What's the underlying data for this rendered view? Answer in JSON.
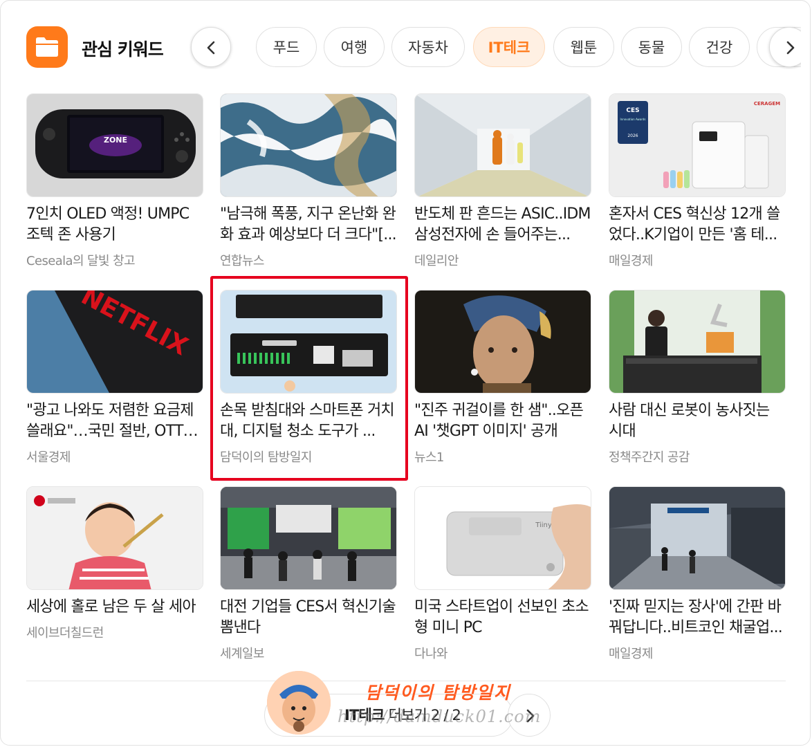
{
  "header": {
    "title": "관심 키워드",
    "tabs": [
      {
        "label": "푸드",
        "active": false
      },
      {
        "label": "여행",
        "active": false
      },
      {
        "label": "자동차",
        "active": false
      },
      {
        "label": "IT테크",
        "active": true
      },
      {
        "label": "웹툰",
        "active": false
      },
      {
        "label": "동물",
        "active": false
      },
      {
        "label": "건강",
        "active": false
      }
    ]
  },
  "cards": [
    {
      "title": "7인치 OLED 액정! UMPC 조텍 존 사용기",
      "source": "Ceseala의 달빛 창고"
    },
    {
      "title": "\"남극해 폭풍, 지구 온난화 완화 효과 예상보다 더 크다\"[...",
      "source": "연합뉴스"
    },
    {
      "title": "반도체 판 흔드는 ASIC..IDM 삼성전자에 손 들어주는...",
      "source": "데일리안"
    },
    {
      "title": "혼자서 CES 혁신상 12개 쓸었다..K기업이 만든 '홈 테...",
      "source": "매일경제"
    },
    {
      "title": "\"광고 나와도 저렴한 요금제 쓸래요\"…국민 절반, OTT '...",
      "source": "서울경제"
    },
    {
      "title": "손목 받침대와 스마트폰 거치대, 디지털 청소 도구가 ...",
      "source": "담덕이의 탐방일지"
    },
    {
      "title": "\"진주 귀걸이를 한 샘\"..오픈AI '챗GPT 이미지' 공개",
      "source": "뉴스1"
    },
    {
      "title": "사람 대신 로봇이 농사짓는 시대",
      "source": "정책주간지 공감"
    },
    {
      "title": "세상에 홀로 남은 두 살 세아",
      "source": "세이브더칠드런"
    },
    {
      "title": "대전 기업들 CES서 혁신기술 뽐낸다",
      "source": "세계일보"
    },
    {
      "title": "미국 스타트업이 선보인 초소형 미니 PC",
      "source": "다나와"
    },
    {
      "title": "'진짜 믿지는 장사'에 간판 바꿔답니다..비트코인 채굴업...",
      "source": "매일경제"
    }
  ],
  "thumb_text": {
    "netflix": "NETFLIX",
    "ces_badge": "CES",
    "ces_badge_sub": "Innovation Awards",
    "ces_year": "2026",
    "brand": "CERAGEM",
    "zone": "ZONE",
    "tiiny": "Tiiny"
  },
  "footer": {
    "more_bold": "IT테크",
    "more_label": " 더보기 2 / 2",
    "watermark_title": "담덕이의 탐방일지",
    "watermark_url": "http://damduck01.com"
  },
  "colors": {
    "accent": "#ff7a1a",
    "highlight": "#e6001e"
  }
}
